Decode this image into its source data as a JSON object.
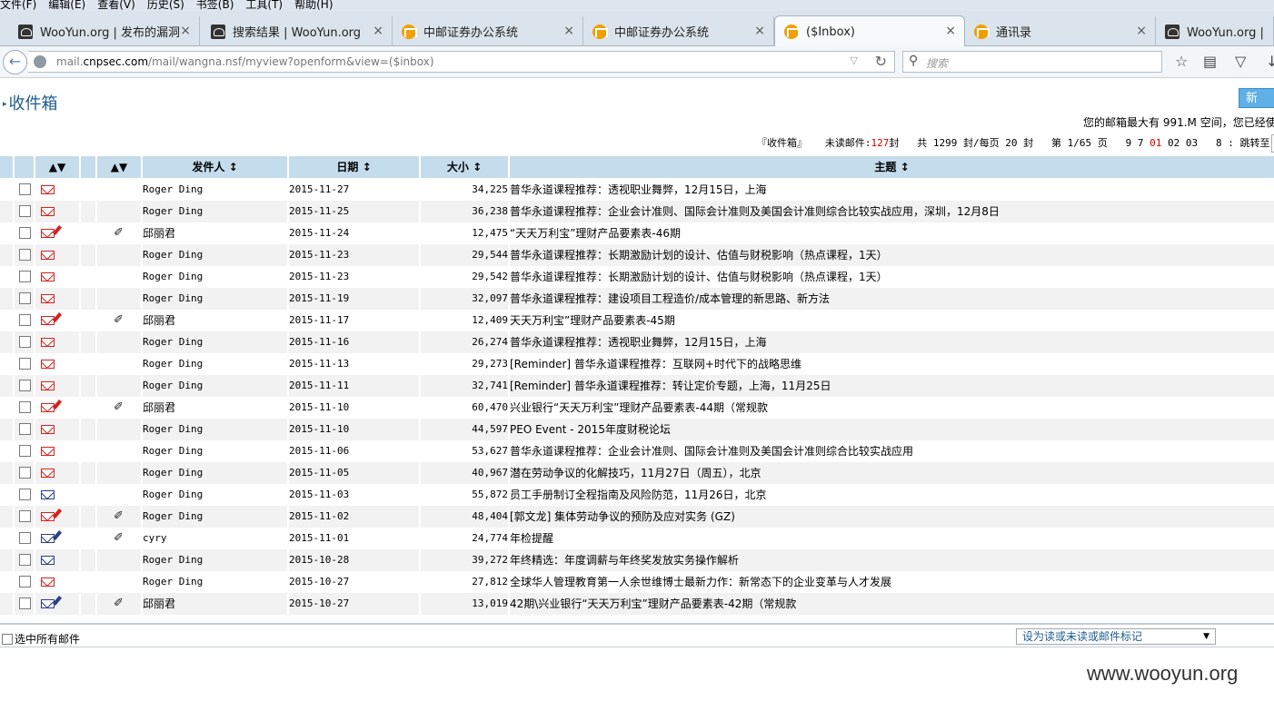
{
  "menu": [
    "文件(F)",
    "编辑(E)",
    "查看(V)",
    "历史(S)",
    "书签(B)",
    "工具(T)",
    "帮助(H)"
  ],
  "tabs": [
    {
      "title": "WooYun.org | 发布的漏洞",
      "icon": "wooyun-icon"
    },
    {
      "title": "搜索结果 | WooYun.org",
      "icon": "wooyun-icon"
    },
    {
      "title": "中邮证券办公系统",
      "icon": "post-icon"
    },
    {
      "title": "中邮证券办公系统",
      "icon": "post-icon"
    },
    {
      "title": "($Inbox)",
      "icon": "post-icon"
    },
    {
      "title": "通讯录",
      "icon": "post-icon"
    },
    {
      "title": "WooYun.org | 自由",
      "icon": "wooyun-icon"
    }
  ],
  "url": {
    "prefix": "mail.",
    "host": "cnpsec.com",
    "path": "/mail/wangna.nsf/myview?openform&view=($inbox)"
  },
  "search": {
    "placeholder": "搜索"
  },
  "page": {
    "title": "收件箱",
    "new_label": "新 建",
    "quota": "您的邮箱最大有 991.M 空间，您已经使",
    "pager": {
      "folder": "『收件箱』",
      "unread_label": "未读邮件:",
      "unread": "127",
      "unread_unit": "封",
      "total": "共 1299 封/每页 20 封",
      "pos": "第 1/65 页",
      "pages_before": "9 7",
      "current": "01",
      "pages_after": "02 03",
      "tail": "8 : 跳转至"
    }
  },
  "columns": {
    "c1": "",
    "c2": "",
    "sender": "发件人",
    "date": "日期",
    "size": "大小",
    "subject": "主题"
  },
  "emails": [
    {
      "sender": "Roger Ding",
      "date": "2015-11-27",
      "size": "34,225",
      "subject": "普华永道课程推荐：透视职业舞弊，12月15日，上海",
      "attach": false,
      "status": "unread"
    },
    {
      "sender": "Roger Ding",
      "date": "2015-11-25",
      "size": "36,238",
      "subject": "普华永道课程推荐：企业会计准则、国际会计准则及美国会计准则综合比较实战应用，深圳，12月8日",
      "attach": false,
      "status": "unread"
    },
    {
      "sender": "邱丽君",
      "date": "2015-11-24",
      "size": "12,475",
      "subject": "“天天万利宝”理财产品要素表-46期",
      "attach": true,
      "status": "unread-reply"
    },
    {
      "sender": "Roger Ding",
      "date": "2015-11-23",
      "size": "29,544",
      "subject": "普华永道课程推荐：长期激励计划的设计、估值与财税影响（热点课程，1天）",
      "attach": false,
      "status": "unread"
    },
    {
      "sender": "Roger Ding",
      "date": "2015-11-23",
      "size": "29,542",
      "subject": "普华永道课程推荐：长期激励计划的设计、估值与财税影响（热点课程，1天）",
      "attach": false,
      "status": "unread"
    },
    {
      "sender": "Roger Ding",
      "date": "2015-11-19",
      "size": "32,097",
      "subject": "普华永道课程推荐：建设项目工程造价/成本管理的新思路、新方法",
      "attach": false,
      "status": "unread"
    },
    {
      "sender": "邱丽君",
      "date": "2015-11-17",
      "size": "12,409",
      "subject": "天天万利宝”理财产品要素表-45期",
      "attach": true,
      "status": "unread-reply"
    },
    {
      "sender": "Roger Ding",
      "date": "2015-11-16",
      "size": "26,274",
      "subject": "普华永道课程推荐：透视职业舞弊，12月15日，上海",
      "attach": false,
      "status": "unread"
    },
    {
      "sender": "Roger Ding",
      "date": "2015-11-13",
      "size": "29,273",
      "subject": "[Reminder] 普华永道课程推荐：互联网+时代下的战略思维",
      "attach": false,
      "status": "unread"
    },
    {
      "sender": "Roger Ding",
      "date": "2015-11-11",
      "size": "32,741",
      "subject": "[Reminder] 普华永道课程推荐：转让定价专题，上海，11月25日",
      "attach": false,
      "status": "unread"
    },
    {
      "sender": "邱丽君",
      "date": "2015-11-10",
      "size": "60,470",
      "subject": "兴业银行“天天万利宝”理财产品要素表-44期（常规款",
      "attach": true,
      "status": "unread-reply"
    },
    {
      "sender": "Roger Ding",
      "date": "2015-11-10",
      "size": "44,597",
      "subject": "PEO Event - 2015年度财税论坛",
      "attach": false,
      "status": "unread"
    },
    {
      "sender": "Roger Ding",
      "date": "2015-11-06",
      "size": "53,627",
      "subject": "普华永道课程推荐：企业会计准则、国际会计准则及美国会计准则综合比较实战应用",
      "attach": false,
      "status": "unread"
    },
    {
      "sender": "Roger Ding",
      "date": "2015-11-05",
      "size": "40,967",
      "subject": "潜在劳动争议的化解技巧，11月27日（周五），北京",
      "attach": false,
      "status": "unread"
    },
    {
      "sender": "Roger Ding",
      "date": "2015-11-03",
      "size": "55,872",
      "subject": "员工手册制订全程指南及风险防范，11月26日，北京",
      "attach": false,
      "status": "read"
    },
    {
      "sender": "Roger Ding",
      "date": "2015-11-02",
      "size": "48,404",
      "subject": "[郭文龙] 集体劳动争议的预防及应对实务 (GZ)",
      "attach": true,
      "status": "unread-reply"
    },
    {
      "sender": "cyry",
      "date": "2015-11-01",
      "size": "24,774",
      "subject": "年检提醒",
      "attach": true,
      "status": "read-reply"
    },
    {
      "sender": "Roger Ding",
      "date": "2015-10-28",
      "size": "39,272",
      "subject": "年终精选：年度调薪与年终奖发放实务操作解析",
      "attach": false,
      "status": "read"
    },
    {
      "sender": "Roger Ding",
      "date": "2015-10-27",
      "size": "27,812",
      "subject": "全球华人管理教育第一人余世维博士最新力作：新常态下的企业变革与人才发展",
      "attach": false,
      "status": "unread"
    },
    {
      "sender": "邱丽君",
      "date": "2015-10-27",
      "size": "13,019",
      "subject": "42期\\兴业银行“天天万利宝”理财产品要素表-42期（常规款",
      "attach": true,
      "status": "read-reply"
    }
  ],
  "footer": {
    "select_all": "选中所有邮件",
    "action_select": "设为读或未读或邮件标记"
  },
  "watermark": "www.wooyun.org"
}
